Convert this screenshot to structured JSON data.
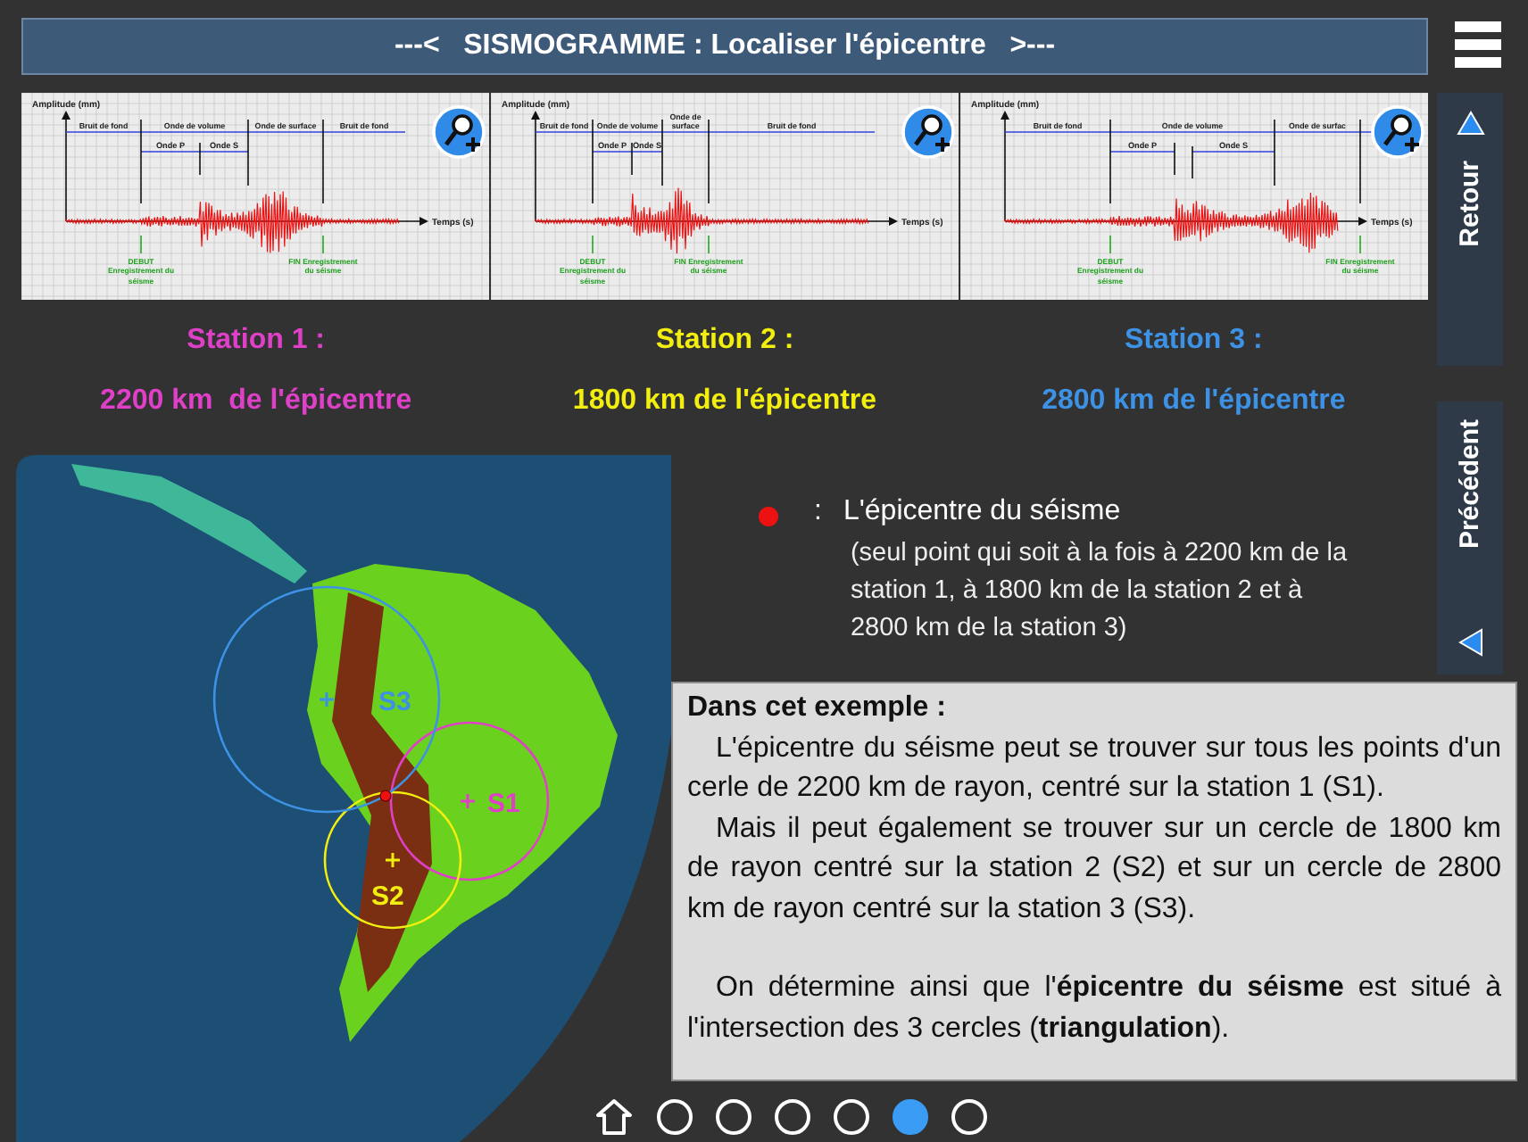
{
  "header": {
    "title": "---<   SISMOGRAMME : Localiser l'épicentre   >---"
  },
  "seismograms": [
    {
      "amplitude_label": "Amplitude (mm)",
      "time_label": "Temps (s)",
      "segments": [
        "Bruit de fond",
        "Onde de volume",
        "Onde de surface",
        "Bruit de fond"
      ],
      "wave_p": "Onde P",
      "wave_s": "Onde S",
      "start_label": "DEBUT Enregistrement du séisme",
      "end_label": "FIN Enregistrement du séisme"
    },
    {
      "amplitude_label": "Amplitude (mm)",
      "time_label": "Temps (s)",
      "segments": [
        "Bruit de fond",
        "Onde de volume",
        "Onde de surface",
        "Bruit de fond"
      ],
      "wave_p": "Onde P",
      "wave_s": "Onde S",
      "start_label": "DEBUT Enregistrement du séisme",
      "end_label": "FIN Enregistrement du séisme"
    },
    {
      "amplitude_label": "Amplitude (mm)",
      "time_label": "Temps (s)",
      "segments": [
        "Bruit de fond",
        "Onde de volume",
        "Onde de surfac"
      ],
      "wave_p": "Onde P",
      "wave_s": "Onde S",
      "start_label": "DEBUT Enregistrement du séisme",
      "end_label": "FIN Enregistrement du séisme"
    }
  ],
  "stations": [
    {
      "name": "Station 1 :",
      "distance": "2200 km  de l'épicentre",
      "map_label": "S1",
      "color": "#e040c8"
    },
    {
      "name": "Station 2 :",
      "distance": "1800 km de l'épicentre",
      "map_label": "S2",
      "color": "#f2ee10"
    },
    {
      "name": "Station 3 :",
      "distance": "2800 km de l'épicentre",
      "map_label": "S3",
      "color": "#3d92e6"
    }
  ],
  "sidebar": [
    {
      "kind": "up",
      "label": "Retour"
    },
    {
      "kind": "left",
      "label": "Précédent"
    }
  ],
  "legend": {
    "separator": ":",
    "title": "L'épicentre du séisme",
    "note": "(seul point qui soit à la fois à 2200 km de la station 1, à 1800 km de la station 2 et à 2800 km de la station 3)"
  },
  "explanation": {
    "title": "Dans cet exemple :",
    "paragraphs": [
      "L'épicentre du séisme peut se trouver sur tous les points d'un cerle de 2200 km de rayon, centré sur la station 1 (S1).",
      "Mais il peut également se trouver sur un cercle de 1800 km de rayon centré sur la station 2 (S2) et sur un cercle de 2800 km de rayon centré sur la station 3 (S3).",
      "On détermine ainsi que l'**épicentre du séisme** est situé à l'intersection des 3 cercles (**triangulation**)."
    ]
  },
  "pager": [
    {
      "kind": "home",
      "selected": false
    },
    {
      "kind": "page",
      "selected": false
    },
    {
      "kind": "page",
      "selected": false
    },
    {
      "kind": "page",
      "selected": false
    },
    {
      "kind": "page",
      "selected": false
    },
    {
      "kind": "page",
      "selected": true
    },
    {
      "kind": "page",
      "selected": false
    }
  ]
}
